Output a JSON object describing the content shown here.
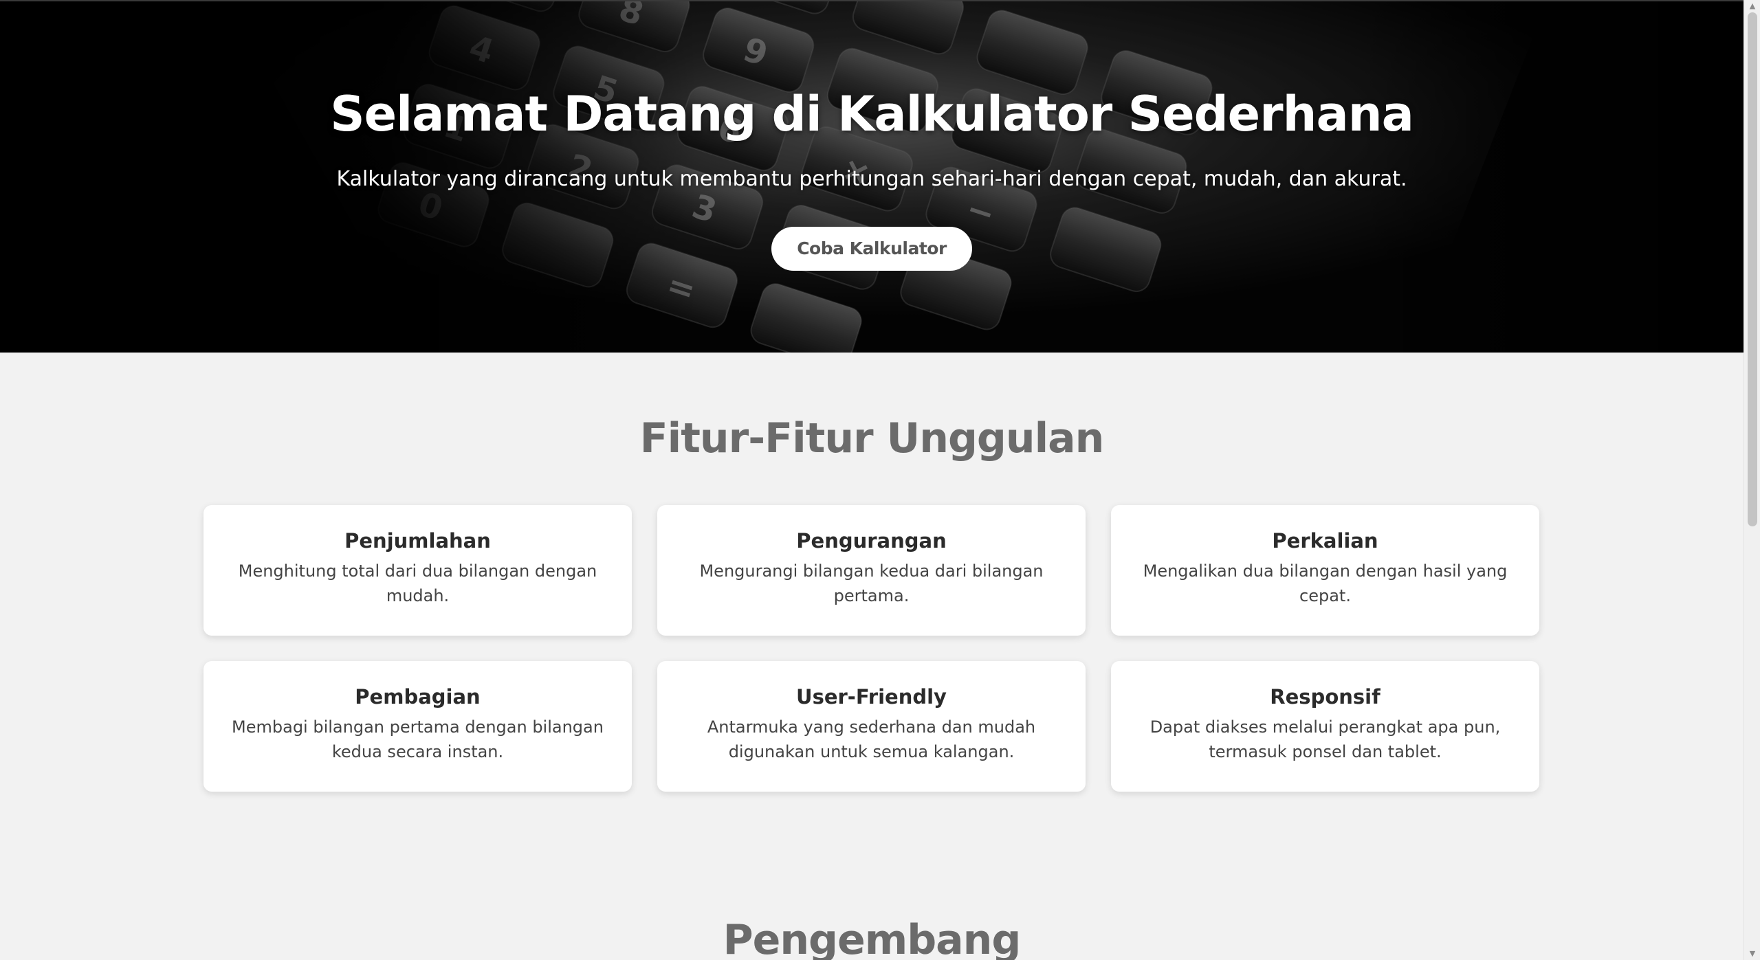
{
  "hero": {
    "title": "Selamat Datang di Kalkulator Sederhana",
    "subtitle": "Kalkulator yang dirancang untuk membantu perhitungan sehari-hari dengan cepat, mudah, dan akurat.",
    "cta_label": "Coba Kalkulator"
  },
  "features": {
    "title": "Fitur-Fitur Unggulan",
    "items": [
      {
        "title": "Penjumlahan",
        "desc": "Menghitung total dari dua bilangan dengan mudah."
      },
      {
        "title": "Pengurangan",
        "desc": "Mengurangi bilangan kedua dari bilangan pertama."
      },
      {
        "title": "Perkalian",
        "desc": "Mengalikan dua bilangan dengan hasil yang cepat."
      },
      {
        "title": "Pembagian",
        "desc": "Membagi bilangan pertama dengan bilangan kedua secara instan."
      },
      {
        "title": "User-Friendly",
        "desc": "Antarmuka yang sederhana dan mudah digunakan untuk semua kalangan."
      },
      {
        "title": "Responsif",
        "desc": "Dapat diakses melalui perangkat apa pun, termasuk ponsel dan tablet."
      }
    ]
  },
  "developers": {
    "title": "Pengembang"
  },
  "icons": {
    "scroll_up": "triangle-up-icon",
    "scroll_down": "triangle-down-icon"
  },
  "colors": {
    "hero_bg": "#050505",
    "page_bg": "#f2f2f2",
    "section_title": "#6b6b6b",
    "card_bg": "#ffffff"
  }
}
